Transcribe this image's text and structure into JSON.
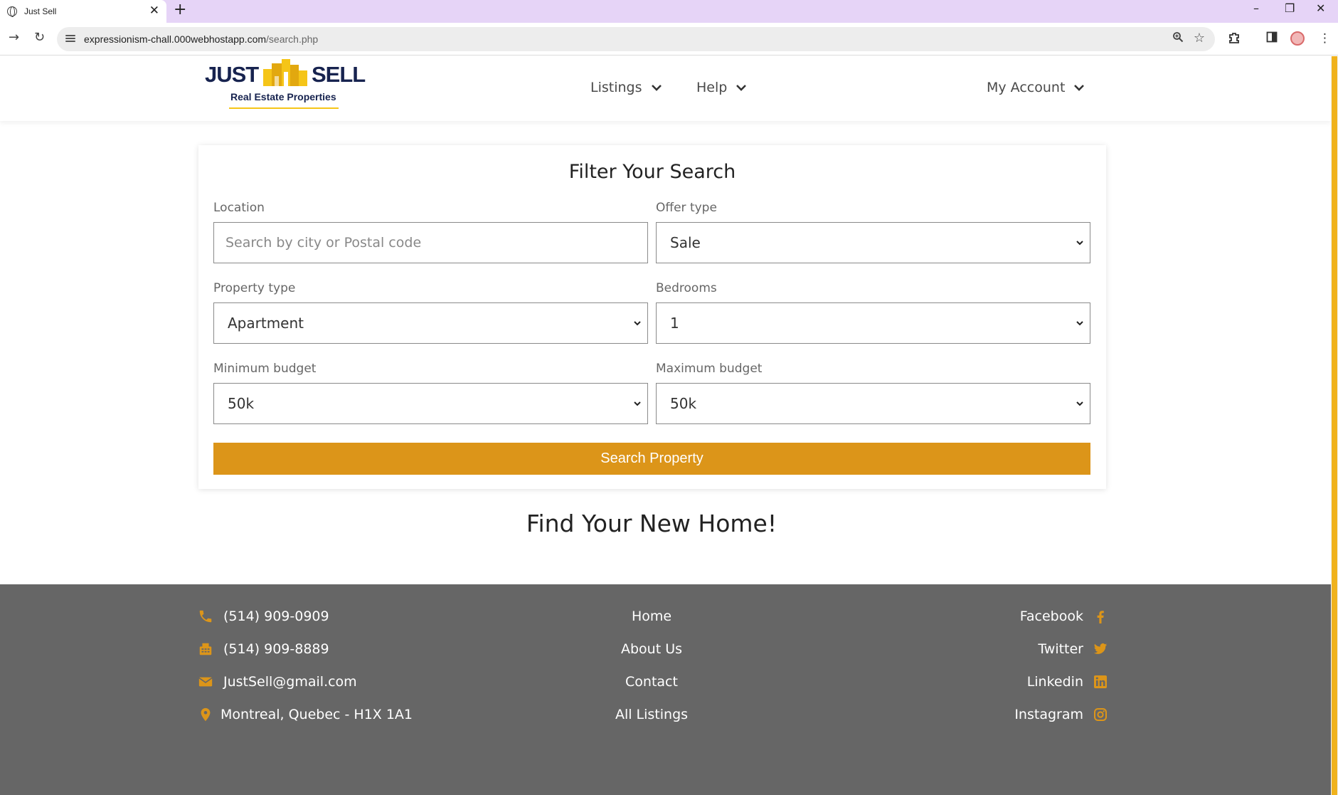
{
  "browser": {
    "tab_title": "Just Sell",
    "url_host": "expressionism-chall.000webhostapp.com",
    "url_path": "/search.php",
    "new_tab": "+",
    "tab_close": "✕",
    "window_controls": [
      "–",
      "❐",
      "✕"
    ]
  },
  "site": {
    "logo": {
      "word_left": "JUST",
      "word_right": "SELL",
      "tagline": "Real Estate Properties"
    },
    "nav": [
      {
        "label": "Listings"
      },
      {
        "label": "Help"
      },
      {
        "label": "My Account"
      }
    ]
  },
  "filter": {
    "title": "Filter Your Search",
    "location": {
      "label": "Location",
      "placeholder": "Search by city or Postal code"
    },
    "offer_type": {
      "label": "Offer type",
      "value": "Sale"
    },
    "property_type": {
      "label": "Property type",
      "value": "Apartment"
    },
    "bedrooms": {
      "label": "Bedrooms",
      "value": "1"
    },
    "min_budget": {
      "label": "Minimum budget",
      "value": "50k"
    },
    "max_budget": {
      "label": "Maximum budget",
      "value": "50k"
    },
    "submit": "Search Property"
  },
  "hero_title": "Find Your New Home!",
  "footer": {
    "contacts": [
      {
        "icon": "phone-icon",
        "text": "(514) 909-0909"
      },
      {
        "icon": "fax-icon",
        "text": "(514) 909-8889"
      },
      {
        "icon": "envelope-icon",
        "text": "JustSell@gmail.com"
      },
      {
        "icon": "location-pin-icon",
        "text": "Montreal, Quebec - H1X 1A1"
      }
    ],
    "links": [
      "Home",
      "About Us",
      "Contact",
      "All Listings"
    ],
    "socials": [
      {
        "name": "Facebook",
        "icon": "facebook-icon"
      },
      {
        "name": "Twitter",
        "icon": "twitter-icon"
      },
      {
        "name": "Linkedin",
        "icon": "linkedin-icon"
      },
      {
        "name": "Instagram",
        "icon": "instagram-icon"
      }
    ]
  },
  "colors": {
    "accent": "#dc9519",
    "footer_bg": "#666666",
    "logo_navy": "#17234f",
    "logo_gold": "#f5c518",
    "tab_strip": "#e6d4f7"
  }
}
